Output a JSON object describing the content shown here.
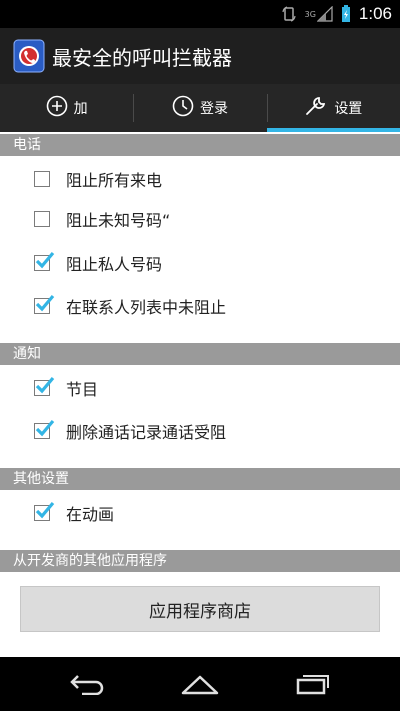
{
  "status_bar": {
    "time": "1:06",
    "network": "3G"
  },
  "app": {
    "title": "最安全的呼叫拦截器"
  },
  "tabs": [
    {
      "label": "加",
      "icon": "add-circle-icon",
      "active": false
    },
    {
      "label": "登录",
      "icon": "clock-icon",
      "active": false
    },
    {
      "label": "设置",
      "icon": "wrench-icon",
      "active": true
    }
  ],
  "sections": {
    "phone": {
      "header": "电话",
      "items": [
        {
          "label": "阻止所有来电",
          "checked": false
        },
        {
          "label": "阻止未知号码“",
          "checked": false
        },
        {
          "label": "阻止私人号码",
          "checked": true
        },
        {
          "label": "在联系人列表中未阻止",
          "checked": true
        }
      ]
    },
    "notify": {
      "header": "通知",
      "items": [
        {
          "label": "节目",
          "checked": true
        },
        {
          "label": "删除通话记录通话受阻",
          "checked": true
        }
      ]
    },
    "other": {
      "header": "其他设置",
      "items": [
        {
          "label": "在动画",
          "checked": true
        }
      ]
    },
    "developer": {
      "header": "从开发商的其他应用程序",
      "button": "应用程序商店"
    }
  },
  "colors": {
    "accent": "#33b5e5",
    "check": "#33b5e5",
    "header_bg": "#9a9a9a"
  }
}
